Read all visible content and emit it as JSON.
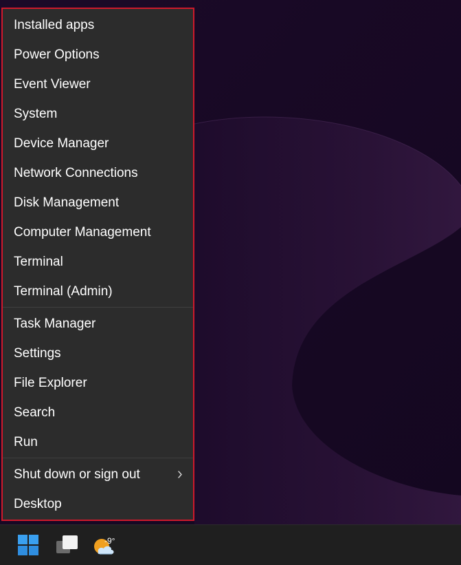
{
  "context_menu": {
    "sections": [
      {
        "items": [
          {
            "label": "Installed apps"
          },
          {
            "label": "Power Options"
          },
          {
            "label": "Event Viewer"
          },
          {
            "label": "System"
          },
          {
            "label": "Device Manager"
          },
          {
            "label": "Network Connections"
          },
          {
            "label": "Disk Management"
          },
          {
            "label": "Computer Management"
          },
          {
            "label": "Terminal"
          },
          {
            "label": "Terminal (Admin)"
          }
        ]
      },
      {
        "items": [
          {
            "label": "Task Manager"
          },
          {
            "label": "Settings"
          },
          {
            "label": "File Explorer"
          },
          {
            "label": "Search"
          },
          {
            "label": "Run"
          }
        ]
      },
      {
        "items": [
          {
            "label": "Shut down or sign out",
            "submenu_icon": "chevron-right-icon"
          },
          {
            "label": "Desktop"
          }
        ]
      }
    ],
    "highlight_border_color": "#d0192b"
  },
  "taskbar": {
    "start_icon": "windows-logo-icon",
    "task_view_icon": "task-view-icon",
    "weather": {
      "temperature": "-9°",
      "icon": "partly-cloudy-night-icon"
    }
  },
  "colors": {
    "menu_background": "#2c2c2c",
    "menu_text": "#ffffff",
    "taskbar_background": "#1f1f1f",
    "wallpaper_base": "#1a0a26",
    "accent_blue": "#3aa0f0"
  }
}
